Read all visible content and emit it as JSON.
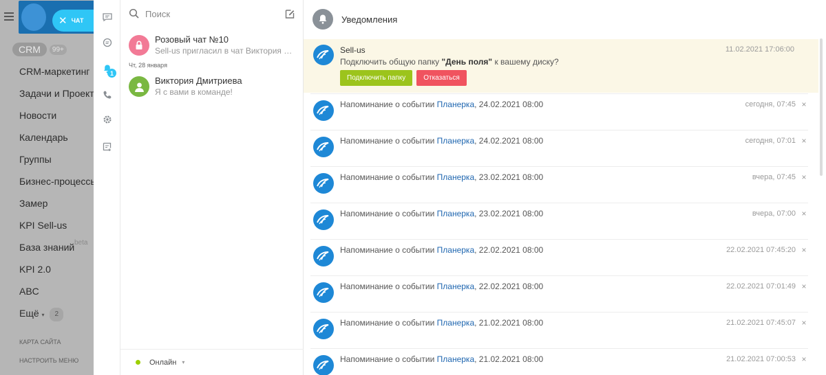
{
  "portal": {
    "crm_label": "CRM",
    "crm_count": "99+",
    "menu": [
      {
        "label": "CRM-маркетинг"
      },
      {
        "label": "Задачи и Проекты"
      },
      {
        "label": "Новости"
      },
      {
        "label": "Календарь"
      },
      {
        "label": "Группы"
      },
      {
        "label": "Бизнес-процессы"
      },
      {
        "label": "Замер"
      },
      {
        "label": "KPI Sell-us"
      },
      {
        "label": "База знаний"
      },
      {
        "label": "KPI 2.0"
      },
      {
        "label": "ABC"
      },
      {
        "label": "Ещё",
        "badge": "2"
      }
    ],
    "beta_label": "beta",
    "more_caret": "▾",
    "sitemap": "КАРТА САЙТА",
    "settings": "НАСТРОИТЬ МЕНЮ"
  },
  "chat_close": {
    "icon": "close-icon",
    "label": "ЧАТ"
  },
  "rail": {
    "items": [
      "chat-icon",
      "open-lines-icon",
      "notifications-icon",
      "phone-icon",
      "settings-icon",
      "export-icon"
    ],
    "notifications_badge": "1"
  },
  "recent": {
    "search_placeholder": "Поиск",
    "chats": [
      {
        "name": "Розовый чат №10",
        "message": "Sell-us пригласил в чат Виктория Дмитриева",
        "avatar": "lock-icon",
        "color": "#f27a96"
      },
      {
        "name": "Виктория Дмитриева",
        "message": "Я с вами в команде!",
        "avatar": "user-icon",
        "color": "#7ab842"
      }
    ],
    "date_separator": "Чт, 28 января",
    "status": "Онлайн",
    "status_caret": "▾"
  },
  "notifications": {
    "title": "Уведомления",
    "invite": {
      "from": "Sell-us",
      "time": "11.02.2021 17:06:00",
      "text_before": "Подключить общую папку ",
      "folder": "\"День поля\"",
      "text_after": " к вашему диску?",
      "accept": "Подключить папку",
      "decline": "Отказаться"
    },
    "rows": [
      {
        "prefix": "Напоминание о событии ",
        "link": "Планерка",
        "suffix": ", 24.02.2021 08:00",
        "time": "сегодня, 07:45"
      },
      {
        "prefix": "Напоминание о событии ",
        "link": "Планерка",
        "suffix": ", 24.02.2021 08:00",
        "time": "сегодня, 07:01"
      },
      {
        "prefix": "Напоминание о событии ",
        "link": "Планерка",
        "suffix": ", 23.02.2021 08:00",
        "time": "вчера, 07:45"
      },
      {
        "prefix": "Напоминание о событии ",
        "link": "Планерка",
        "suffix": ", 23.02.2021 08:00",
        "time": "вчера, 07:00"
      },
      {
        "prefix": "Напоминание о событии ",
        "link": "Планерка",
        "suffix": ", 22.02.2021 08:00",
        "time": "22.02.2021 07:45:20"
      },
      {
        "prefix": "Напоминание о событии ",
        "link": "Планерка",
        "suffix": ", 22.02.2021 08:00",
        "time": "22.02.2021 07:01:49"
      },
      {
        "prefix": "Напоминание о событии ",
        "link": "Планерка",
        "suffix": ", 21.02.2021 08:00",
        "time": "21.02.2021 07:45:07"
      },
      {
        "prefix": "Напоминание о событии ",
        "link": "Планерка",
        "suffix": ", 21.02.2021 08:00",
        "time": "21.02.2021 07:00:53"
      }
    ],
    "close_glyph": "×"
  }
}
